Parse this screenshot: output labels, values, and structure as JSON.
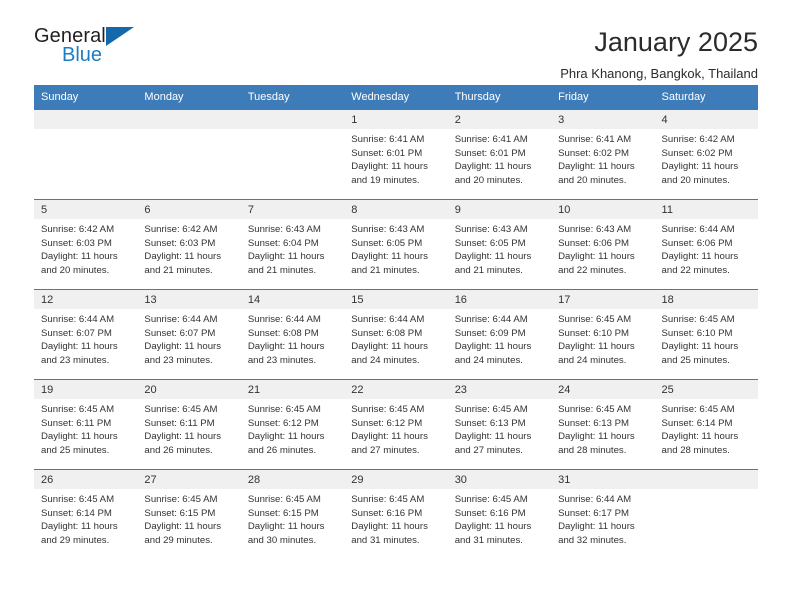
{
  "brand": {
    "name_part1": "General",
    "name_part2": "Blue",
    "accent_color": "#1d7dc2",
    "triangle_color": "#1668ad"
  },
  "header": {
    "title": "January 2025",
    "subtitle": "Phra Khanong, Bangkok, Thailand",
    "header_bg_color": "#3e7cb9",
    "daynum_bg_color": "#f0f0f0"
  },
  "calendar": {
    "weekday_headers": [
      "Sunday",
      "Monday",
      "Tuesday",
      "Wednesday",
      "Thursday",
      "Friday",
      "Saturday"
    ],
    "weeks": [
      [
        {
          "day": "",
          "sunrise": "",
          "sunset": "",
          "daylight": "",
          "daylight2": ""
        },
        {
          "day": "",
          "sunrise": "",
          "sunset": "",
          "daylight": "",
          "daylight2": ""
        },
        {
          "day": "",
          "sunrise": "",
          "sunset": "",
          "daylight": "",
          "daylight2": ""
        },
        {
          "day": "1",
          "sunrise": "Sunrise: 6:41 AM",
          "sunset": "Sunset: 6:01 PM",
          "daylight": "Daylight: 11 hours",
          "daylight2": "and 19 minutes."
        },
        {
          "day": "2",
          "sunrise": "Sunrise: 6:41 AM",
          "sunset": "Sunset: 6:01 PM",
          "daylight": "Daylight: 11 hours",
          "daylight2": "and 20 minutes."
        },
        {
          "day": "3",
          "sunrise": "Sunrise: 6:41 AM",
          "sunset": "Sunset: 6:02 PM",
          "daylight": "Daylight: 11 hours",
          "daylight2": "and 20 minutes."
        },
        {
          "day": "4",
          "sunrise": "Sunrise: 6:42 AM",
          "sunset": "Sunset: 6:02 PM",
          "daylight": "Daylight: 11 hours",
          "daylight2": "and 20 minutes."
        }
      ],
      [
        {
          "day": "5",
          "sunrise": "Sunrise: 6:42 AM",
          "sunset": "Sunset: 6:03 PM",
          "daylight": "Daylight: 11 hours",
          "daylight2": "and 20 minutes."
        },
        {
          "day": "6",
          "sunrise": "Sunrise: 6:42 AM",
          "sunset": "Sunset: 6:03 PM",
          "daylight": "Daylight: 11 hours",
          "daylight2": "and 21 minutes."
        },
        {
          "day": "7",
          "sunrise": "Sunrise: 6:43 AM",
          "sunset": "Sunset: 6:04 PM",
          "daylight": "Daylight: 11 hours",
          "daylight2": "and 21 minutes."
        },
        {
          "day": "8",
          "sunrise": "Sunrise: 6:43 AM",
          "sunset": "Sunset: 6:05 PM",
          "daylight": "Daylight: 11 hours",
          "daylight2": "and 21 minutes."
        },
        {
          "day": "9",
          "sunrise": "Sunrise: 6:43 AM",
          "sunset": "Sunset: 6:05 PM",
          "daylight": "Daylight: 11 hours",
          "daylight2": "and 21 minutes."
        },
        {
          "day": "10",
          "sunrise": "Sunrise: 6:43 AM",
          "sunset": "Sunset: 6:06 PM",
          "daylight": "Daylight: 11 hours",
          "daylight2": "and 22 minutes."
        },
        {
          "day": "11",
          "sunrise": "Sunrise: 6:44 AM",
          "sunset": "Sunset: 6:06 PM",
          "daylight": "Daylight: 11 hours",
          "daylight2": "and 22 minutes."
        }
      ],
      [
        {
          "day": "12",
          "sunrise": "Sunrise: 6:44 AM",
          "sunset": "Sunset: 6:07 PM",
          "daylight": "Daylight: 11 hours",
          "daylight2": "and 23 minutes."
        },
        {
          "day": "13",
          "sunrise": "Sunrise: 6:44 AM",
          "sunset": "Sunset: 6:07 PM",
          "daylight": "Daylight: 11 hours",
          "daylight2": "and 23 minutes."
        },
        {
          "day": "14",
          "sunrise": "Sunrise: 6:44 AM",
          "sunset": "Sunset: 6:08 PM",
          "daylight": "Daylight: 11 hours",
          "daylight2": "and 23 minutes."
        },
        {
          "day": "15",
          "sunrise": "Sunrise: 6:44 AM",
          "sunset": "Sunset: 6:08 PM",
          "daylight": "Daylight: 11 hours",
          "daylight2": "and 24 minutes."
        },
        {
          "day": "16",
          "sunrise": "Sunrise: 6:44 AM",
          "sunset": "Sunset: 6:09 PM",
          "daylight": "Daylight: 11 hours",
          "daylight2": "and 24 minutes."
        },
        {
          "day": "17",
          "sunrise": "Sunrise: 6:45 AM",
          "sunset": "Sunset: 6:10 PM",
          "daylight": "Daylight: 11 hours",
          "daylight2": "and 24 minutes."
        },
        {
          "day": "18",
          "sunrise": "Sunrise: 6:45 AM",
          "sunset": "Sunset: 6:10 PM",
          "daylight": "Daylight: 11 hours",
          "daylight2": "and 25 minutes."
        }
      ],
      [
        {
          "day": "19",
          "sunrise": "Sunrise: 6:45 AM",
          "sunset": "Sunset: 6:11 PM",
          "daylight": "Daylight: 11 hours",
          "daylight2": "and 25 minutes."
        },
        {
          "day": "20",
          "sunrise": "Sunrise: 6:45 AM",
          "sunset": "Sunset: 6:11 PM",
          "daylight": "Daylight: 11 hours",
          "daylight2": "and 26 minutes."
        },
        {
          "day": "21",
          "sunrise": "Sunrise: 6:45 AM",
          "sunset": "Sunset: 6:12 PM",
          "daylight": "Daylight: 11 hours",
          "daylight2": "and 26 minutes."
        },
        {
          "day": "22",
          "sunrise": "Sunrise: 6:45 AM",
          "sunset": "Sunset: 6:12 PM",
          "daylight": "Daylight: 11 hours",
          "daylight2": "and 27 minutes."
        },
        {
          "day": "23",
          "sunrise": "Sunrise: 6:45 AM",
          "sunset": "Sunset: 6:13 PM",
          "daylight": "Daylight: 11 hours",
          "daylight2": "and 27 minutes."
        },
        {
          "day": "24",
          "sunrise": "Sunrise: 6:45 AM",
          "sunset": "Sunset: 6:13 PM",
          "daylight": "Daylight: 11 hours",
          "daylight2": "and 28 minutes."
        },
        {
          "day": "25",
          "sunrise": "Sunrise: 6:45 AM",
          "sunset": "Sunset: 6:14 PM",
          "daylight": "Daylight: 11 hours",
          "daylight2": "and 28 minutes."
        }
      ],
      [
        {
          "day": "26",
          "sunrise": "Sunrise: 6:45 AM",
          "sunset": "Sunset: 6:14 PM",
          "daylight": "Daylight: 11 hours",
          "daylight2": "and 29 minutes."
        },
        {
          "day": "27",
          "sunrise": "Sunrise: 6:45 AM",
          "sunset": "Sunset: 6:15 PM",
          "daylight": "Daylight: 11 hours",
          "daylight2": "and 29 minutes."
        },
        {
          "day": "28",
          "sunrise": "Sunrise: 6:45 AM",
          "sunset": "Sunset: 6:15 PM",
          "daylight": "Daylight: 11 hours",
          "daylight2": "and 30 minutes."
        },
        {
          "day": "29",
          "sunrise": "Sunrise: 6:45 AM",
          "sunset": "Sunset: 6:16 PM",
          "daylight": "Daylight: 11 hours",
          "daylight2": "and 31 minutes."
        },
        {
          "day": "30",
          "sunrise": "Sunrise: 6:45 AM",
          "sunset": "Sunset: 6:16 PM",
          "daylight": "Daylight: 11 hours",
          "daylight2": "and 31 minutes."
        },
        {
          "day": "31",
          "sunrise": "Sunrise: 6:44 AM",
          "sunset": "Sunset: 6:17 PM",
          "daylight": "Daylight: 11 hours",
          "daylight2": "and 32 minutes."
        },
        {
          "day": "",
          "sunrise": "",
          "sunset": "",
          "daylight": "",
          "daylight2": ""
        }
      ]
    ]
  }
}
